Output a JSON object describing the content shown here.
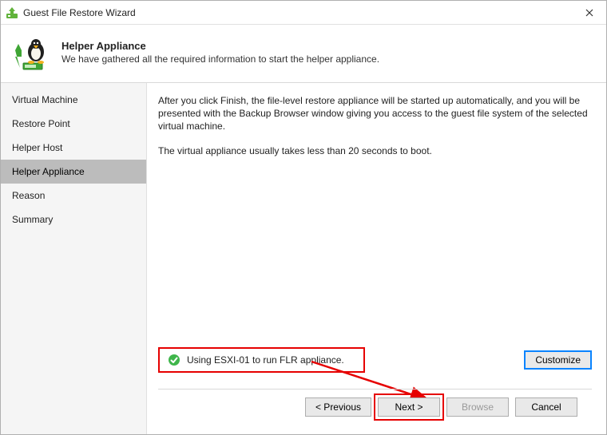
{
  "window": {
    "title": "Guest File Restore Wizard"
  },
  "header": {
    "title": "Helper Appliance",
    "subtitle": "We have gathered all the required information to start the helper appliance."
  },
  "sidebar": {
    "items": [
      {
        "label": "Virtual Machine"
      },
      {
        "label": "Restore Point"
      },
      {
        "label": "Helper Host"
      },
      {
        "label": "Helper Appliance"
      },
      {
        "label": "Reason"
      },
      {
        "label": "Summary"
      }
    ],
    "selected_index": 3
  },
  "content": {
    "para1": "After you click Finish, the file-level restore appliance will be started up automatically, and you will be presented with the Backup Browser window giving you access to the guest file system of the selected virtual machine.",
    "para2": "The virtual appliance usually takes less than 20 seconds to boot.",
    "status_text": "Using ESXI-01 to run FLR appliance.",
    "customize_label": "Customize"
  },
  "footer": {
    "previous": "< Previous",
    "next": "Next >",
    "browse": "Browse",
    "cancel": "Cancel"
  },
  "annotations": {
    "highlight_status": true,
    "highlight_next": true
  },
  "colors": {
    "highlight": "#e60000",
    "accent": "#0a84ff"
  }
}
